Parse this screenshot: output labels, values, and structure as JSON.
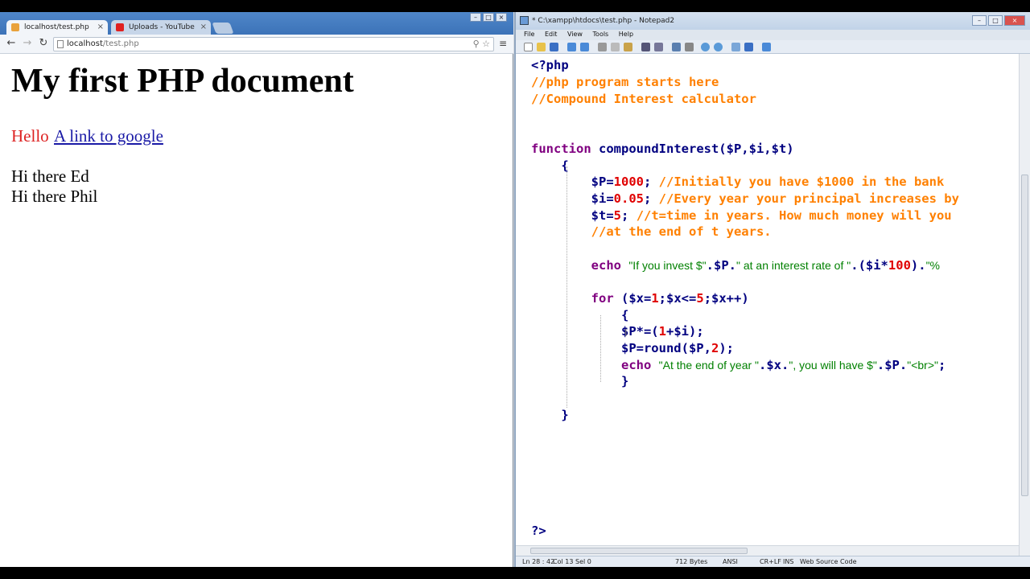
{
  "browser": {
    "tabs": [
      {
        "label": "localhost/test.php",
        "active": true,
        "icon": "php-file-icon"
      },
      {
        "label": "Uploads - YouTube",
        "active": false,
        "icon": "youtube-icon"
      }
    ],
    "address": {
      "host": "localhost",
      "path": "/test.php"
    },
    "page": {
      "heading": "My first PHP document",
      "hello": "Hello",
      "link": "A link to google",
      "lines": [
        "Hi there Ed",
        "Hi there Phil"
      ]
    }
  },
  "editor": {
    "title": "* C:\\xampp\\htdocs\\test.php - Notepad2",
    "menu": [
      "File",
      "Edit",
      "View",
      "Tools",
      "Help"
    ],
    "status": {
      "position": "Ln 28 : 42",
      "col": "Col 13",
      "sel": "Sel 0",
      "size": "712 Bytes",
      "encoding": "ANSI",
      "eol": "CR+LF",
      "ins": "INS",
      "scheme": "Web Source Code"
    },
    "colors": {
      "keyword": "#800080",
      "comment": "#ff8000",
      "number": "#e00000",
      "string": "#008000",
      "identifier": "#000080"
    }
  }
}
